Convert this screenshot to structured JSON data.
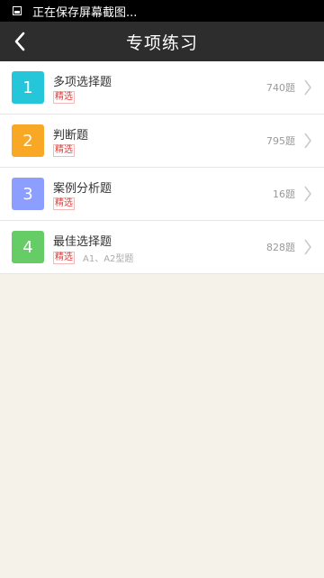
{
  "status_bar": {
    "message": "正在保存屏幕截图...",
    "icon": "screenshot-icon"
  },
  "header": {
    "title": "专项练习",
    "back_icon": "chevron-left-icon"
  },
  "items": [
    {
      "number": "1",
      "title": "多项选择题",
      "tag": "精选",
      "subtitle": "",
      "count": "740题",
      "color": "#26c6da"
    },
    {
      "number": "2",
      "title": "判断题",
      "tag": "精选",
      "subtitle": "",
      "count": "795题",
      "color": "#f9a825"
    },
    {
      "number": "3",
      "title": "案例分析题",
      "tag": "精选",
      "subtitle": "",
      "count": "16题",
      "color": "#8c9eff"
    },
    {
      "number": "4",
      "title": "最佳选择题",
      "tag": "精选",
      "subtitle": "A1、A2型题",
      "count": "828题",
      "color": "#66cc66"
    }
  ]
}
